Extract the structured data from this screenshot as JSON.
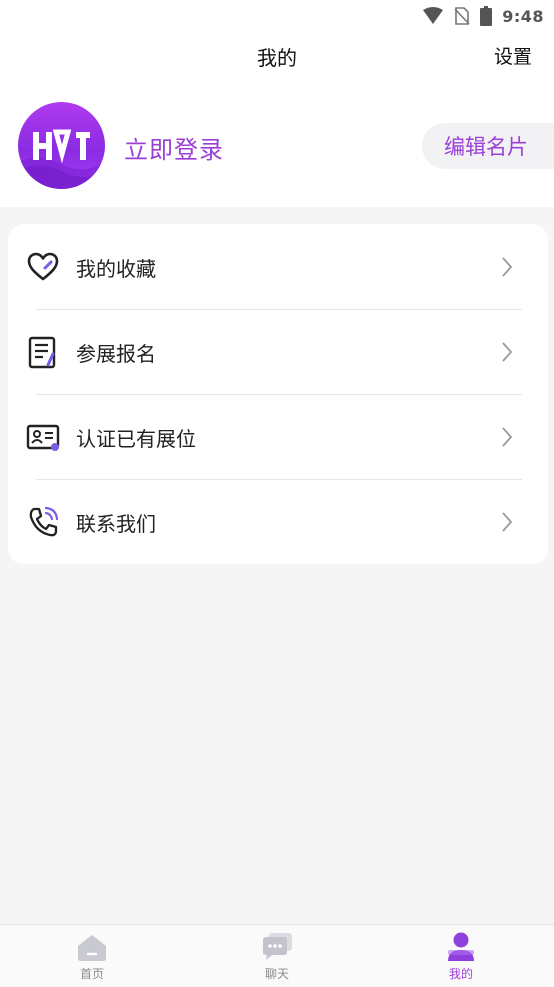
{
  "status_bar": {
    "time": "9:48",
    "icons": [
      "wifi-icon",
      "no-sim-icon",
      "battery-icon"
    ]
  },
  "nav": {
    "title": "我的",
    "settings_label": "设置"
  },
  "profile": {
    "avatar_logo_text": "HVI",
    "login_label": "立即登录",
    "edit_card_label": "编辑名片"
  },
  "menu": {
    "items": [
      {
        "label": "我的收藏",
        "icon": "heart-icon"
      },
      {
        "label": "参展报名",
        "icon": "document-edit-icon"
      },
      {
        "label": "认证已有展位",
        "icon": "id-card-icon"
      },
      {
        "label": "联系我们",
        "icon": "phone-icon"
      }
    ]
  },
  "tabs": [
    {
      "label": "首页",
      "icon": "home-icon",
      "active": false
    },
    {
      "label": "聊天",
      "icon": "chat-icon",
      "active": false
    },
    {
      "label": "我的",
      "icon": "user-icon",
      "active": true
    }
  ],
  "colors": {
    "accent": "#9b3fd6",
    "inactive": "#8b8b8b",
    "background": "#f5f5f5"
  }
}
